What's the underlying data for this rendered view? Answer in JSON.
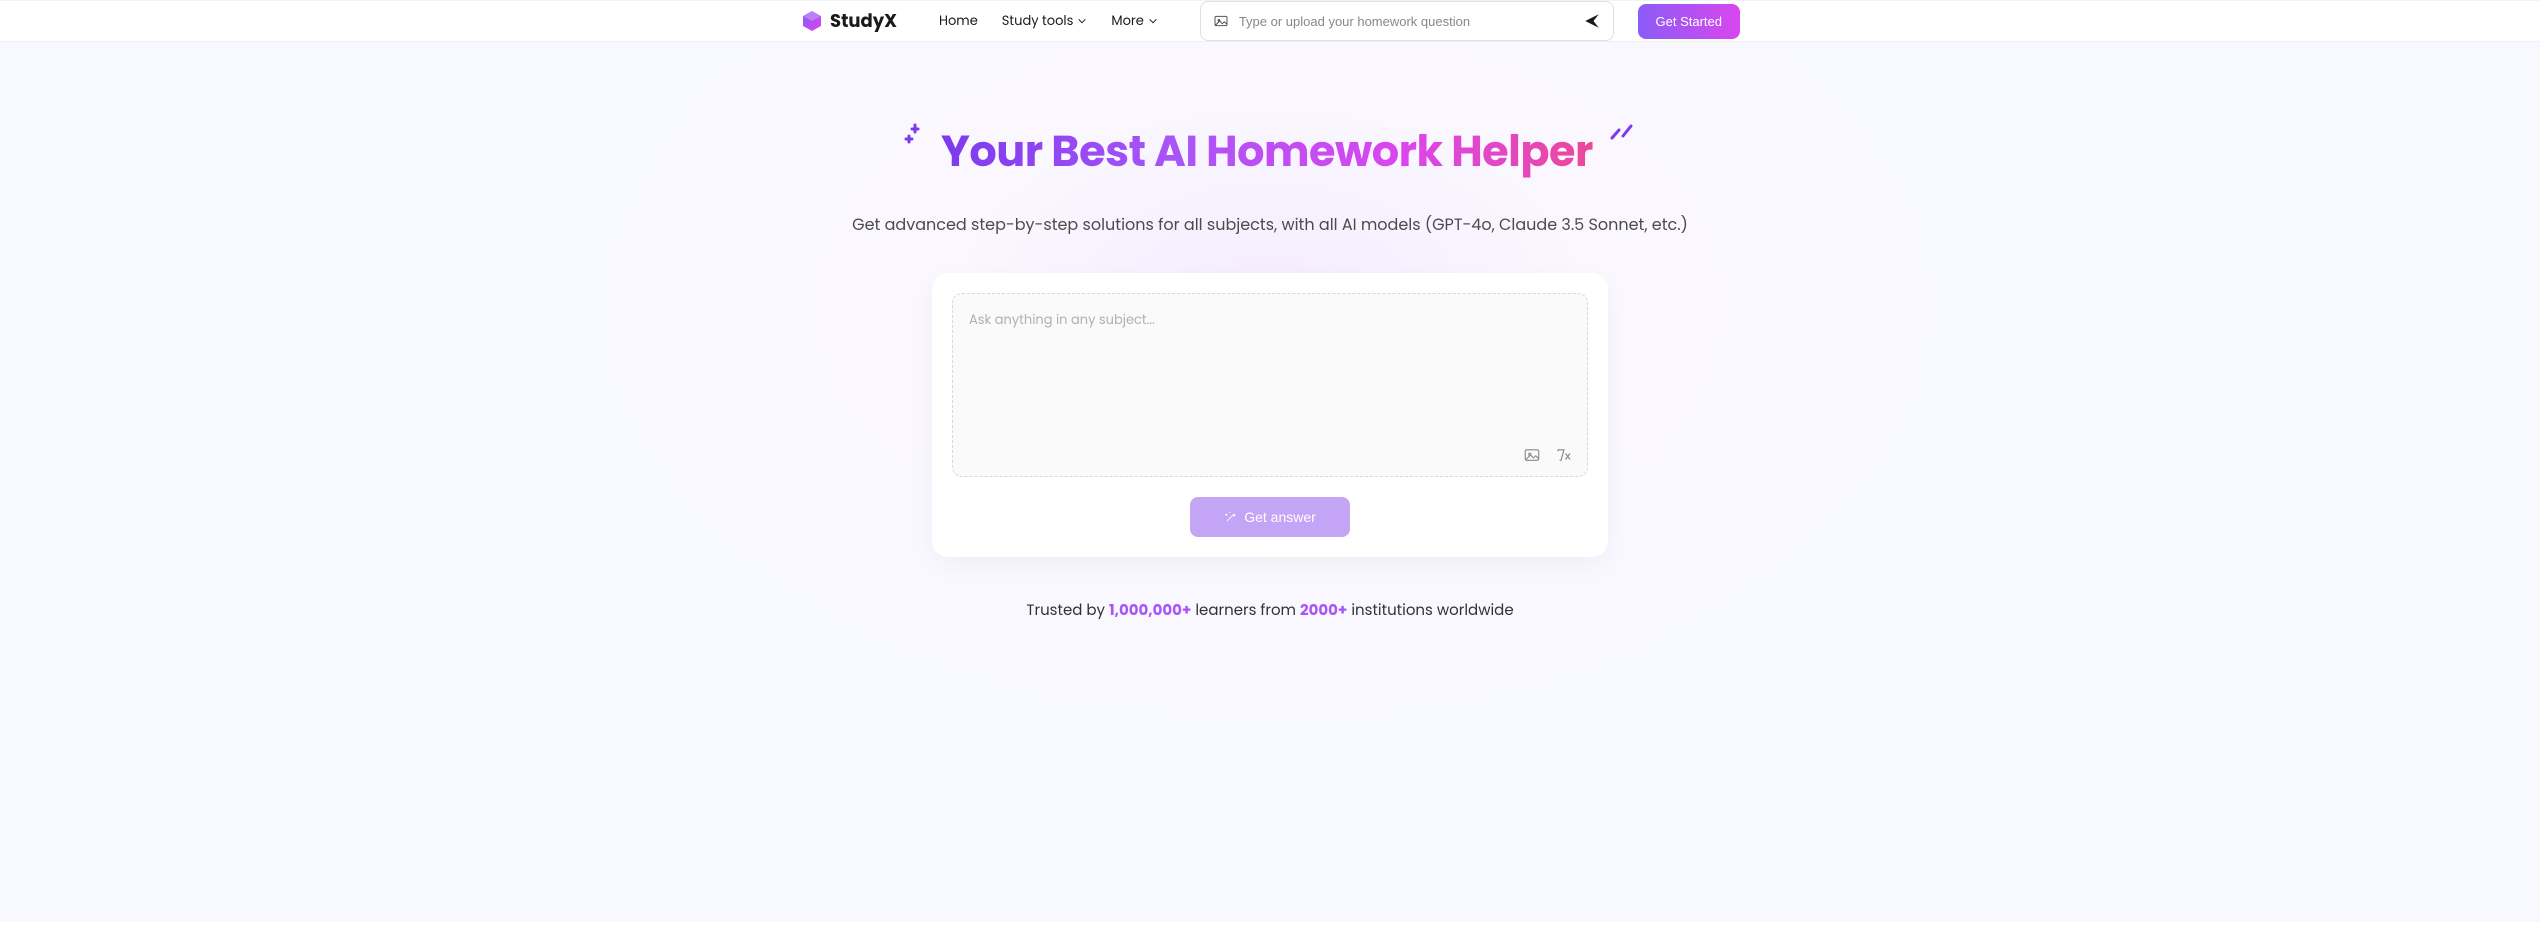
{
  "header": {
    "logo_text": "StudyX",
    "nav": {
      "home": "Home",
      "study_tools": "Study tools",
      "more": "More"
    },
    "search_placeholder": "Type or upload your homework question",
    "cta": "Get Started"
  },
  "hero": {
    "title": "Your Best AI Homework Helper",
    "subtitle": "Get advanced step-by-step solutions for all subjects, with all AI models (GPT-4o, Claude 3.5 Sonnet, etc.)"
  },
  "input": {
    "placeholder": "Ask anything in any subject...",
    "button": "Get answer"
  },
  "trust": {
    "prefix": "Trusted by ",
    "count1": "1,000,000+",
    "mid": " learners from ",
    "count2": "2000+",
    "suffix": " institutions worldwide"
  }
}
